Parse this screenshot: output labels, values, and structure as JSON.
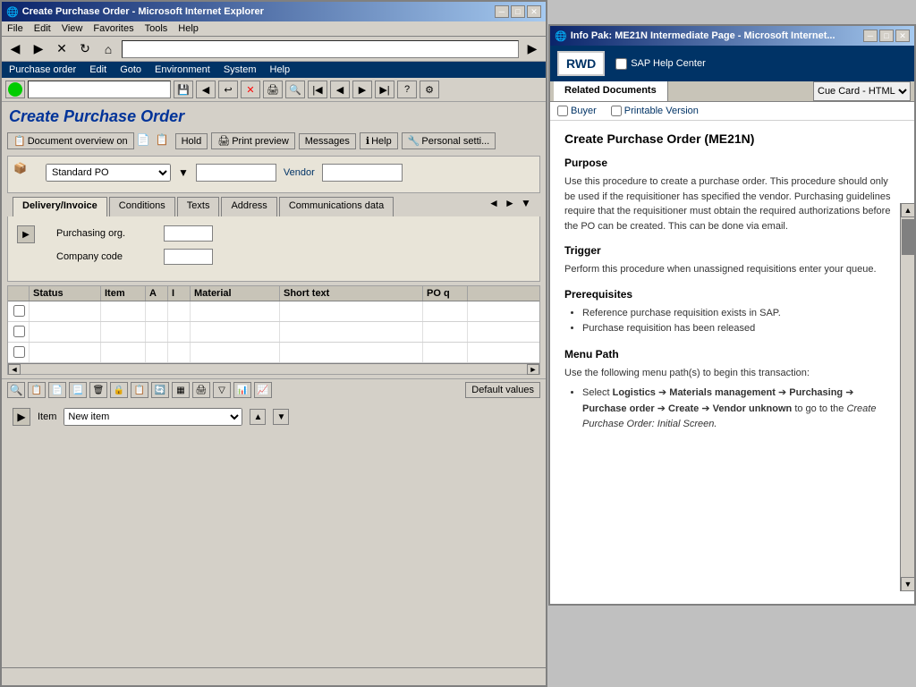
{
  "main_window": {
    "title": "Create Purchase Order - Microsoft Internet Explorer",
    "menubar": [
      "File",
      "Edit",
      "View",
      "Favorites",
      "Tools",
      "Help"
    ],
    "nav_items": [
      "Purchase order",
      "Edit",
      "Goto",
      "Environment",
      "System",
      "Help"
    ],
    "page_title": "Create Purchase Order",
    "action_buttons": [
      {
        "label": "Document overview on",
        "icon": "📄"
      },
      {
        "label": "Hold"
      },
      {
        "label": "Print preview"
      },
      {
        "label": "Messages"
      },
      {
        "label": "Help"
      },
      {
        "label": "Personal setti..."
      }
    ],
    "po_type": "Standard PO",
    "vendor_label": "Vendor",
    "tabs": [
      "Delivery/Invoice",
      "Conditions",
      "Texts",
      "Address",
      "Communications data"
    ],
    "fields": [
      {
        "label": "Purchasing org.",
        "value": ""
      },
      {
        "label": "Company code",
        "value": ""
      }
    ],
    "table": {
      "columns": [
        "",
        "Status",
        "Item",
        "A",
        "I",
        "Material",
        "Short text",
        "PO q"
      ],
      "rows": [
        {
          "check": false,
          "status": "    ",
          "item": "",
          "a": "",
          "i": "",
          "material": "",
          "short": "",
          "po": ""
        },
        {
          "check": false,
          "status": "    ",
          "item": "",
          "a": "",
          "i": "",
          "material": "",
          "short": "",
          "po": ""
        },
        {
          "check": false,
          "status": "    ",
          "item": "",
          "a": "",
          "i": "",
          "material": "",
          "short": "",
          "po": ""
        }
      ]
    },
    "bottom_item_label": "Item",
    "bottom_item_value": "New item",
    "default_values_btn": "Default values",
    "status_bar": ""
  },
  "help_window": {
    "title": "Info Pak: ME21N Intermediate Page - Microsoft Internet...",
    "logo": "RWD",
    "sap_help_center": "SAP Help Center",
    "related_documents_tab": "Related Documents",
    "cue_card_option": "Cue Card - HTML",
    "links": [
      {
        "label": "Buyer",
        "checked": false
      },
      {
        "label": "Printable Version",
        "checked": false
      }
    ],
    "content": {
      "main_title": "Create Purchase Order (ME21N)",
      "sections": [
        {
          "title": "Purpose",
          "body": "Use this procedure to create a purchase order. This procedure should only be used if the requisitioner has specified the vendor. Purchasing guidelines require that the requisitioner must obtain the required authorizations before the PO can be created. This can be done via email."
        },
        {
          "title": "Trigger",
          "body": "Perform this procedure when unassigned requisitions enter your queue."
        },
        {
          "title": "Prerequisites",
          "items": [
            "Reference purchase requisition exists in SAP.",
            "Purchase requisition has been released"
          ]
        },
        {
          "title": "Menu Path",
          "body": "Use the following menu path(s) to begin this transaction:",
          "list_items": [
            {
              "text": "Select Logistics → Materials management → Purchasing → Purchase order → Create → Vendor unknown to go to the ",
              "italic": "Create Purchase Order: Initial Screen."
            }
          ]
        }
      ]
    }
  },
  "icons": {
    "minimize": "─",
    "maximize": "□",
    "close": "✕",
    "back": "◀",
    "forward": "▶",
    "stop": "✕",
    "refresh": "↻",
    "home": "⌂",
    "search": "🔍",
    "favorites": "★",
    "print": "🖨",
    "arrow_up": "▲",
    "arrow_down": "▼",
    "arrow_left": "◄",
    "arrow_right": "►"
  }
}
